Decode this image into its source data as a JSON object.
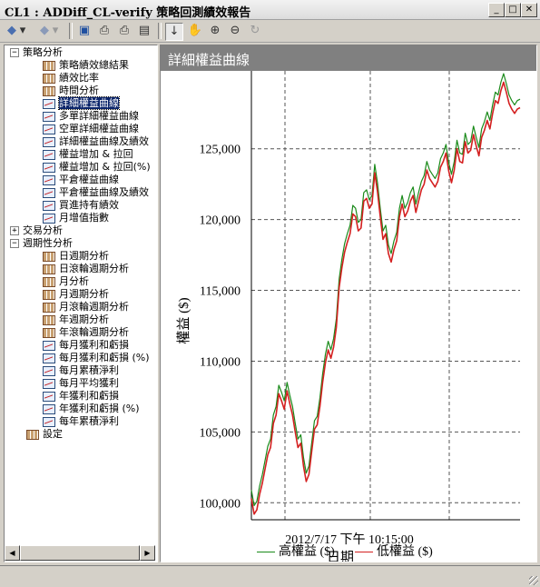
{
  "window": {
    "title": "CL1 : ADDiff_CL-verify 策略回測績效報告",
    "minimize": "_",
    "maximize": "□",
    "close": "✕"
  },
  "toolbar": {
    "back": "◆",
    "back_dd": "▾",
    "forward": "◆",
    "forward_dd": "▾",
    "save": "▣",
    "preview": "⎙",
    "print": "⎙",
    "grid": "▤",
    "pointer": "↓",
    "pan": "✋",
    "zoom_in": "⊕",
    "zoom_out": "⊖",
    "reset": "↻"
  },
  "tree": {
    "items": [
      {
        "label": "策略分析",
        "type": "group",
        "expander": "−"
      },
      {
        "label": "策略績效總結果",
        "type": "leaf"
      },
      {
        "label": "績效比率",
        "type": "leaf"
      },
      {
        "label": "時間分析",
        "type": "leaf"
      },
      {
        "label": "詳細權益曲線",
        "type": "chart",
        "selected": true
      },
      {
        "label": "多單詳細權益曲線",
        "type": "chart"
      },
      {
        "label": "空單詳細權益曲線",
        "type": "chart"
      },
      {
        "label": "詳細權益曲線及績效",
        "type": "chart"
      },
      {
        "label": "權益增加 & 拉回",
        "type": "chart"
      },
      {
        "label": "權益增加 & 拉回(%)",
        "type": "chart"
      },
      {
        "label": "平倉權益曲線",
        "type": "chart"
      },
      {
        "label": "平倉權益曲線及績效",
        "type": "chart"
      },
      {
        "label": "買進持有績效",
        "type": "chart"
      },
      {
        "label": "月增值指數",
        "type": "chart"
      },
      {
        "label": "交易分析",
        "type": "group",
        "expander": "+"
      },
      {
        "label": "週期性分析",
        "type": "group",
        "expander": "−"
      },
      {
        "label": "日週期分析",
        "type": "leaf"
      },
      {
        "label": "日滾輪週期分析",
        "type": "leaf"
      },
      {
        "label": "月分析",
        "type": "leaf"
      },
      {
        "label": "月週期分析",
        "type": "leaf"
      },
      {
        "label": "月滾輪週期分析",
        "type": "leaf"
      },
      {
        "label": "年週期分析",
        "type": "leaf"
      },
      {
        "label": "年滾輪週期分析",
        "type": "leaf"
      },
      {
        "label": "每月獲利和虧損",
        "type": "chart"
      },
      {
        "label": "每月獲利和虧損 (%)",
        "type": "chart"
      },
      {
        "label": "每月累積淨利",
        "type": "chart"
      },
      {
        "label": "每月平均獲利",
        "type": "chart"
      },
      {
        "label": "年獲利和虧損",
        "type": "chart"
      },
      {
        "label": "年獲利和虧損 (%)",
        "type": "chart"
      },
      {
        "label": "每年累積淨利",
        "type": "chart"
      },
      {
        "label": "設定",
        "type": "leaf"
      }
    ]
  },
  "scroll": {
    "left": "◀",
    "right": "▶"
  },
  "panel": {
    "title": "詳細權益曲線"
  },
  "chart_data": {
    "type": "line",
    "title": "",
    "xlabel": "日期",
    "ylabel": "權益 ($)",
    "xtick_label": "2012/7/17 下午 10:15:00",
    "yticks": [
      100000,
      105000,
      110000,
      115000,
      120000,
      125000
    ],
    "ytick_labels": [
      "100,000",
      "105,000",
      "110,000",
      "115,000",
      "120,000",
      "125,000"
    ],
    "ylim": [
      98800,
      130500
    ],
    "grid": true,
    "legend_position": "bottom",
    "x": [
      0,
      3,
      6,
      9,
      12,
      15,
      18,
      21,
      24,
      27,
      30,
      33,
      36,
      39,
      42,
      45,
      48,
      51,
      54,
      57,
      60,
      63,
      66,
      69,
      72,
      75,
      78,
      81,
      84,
      87,
      90,
      93,
      96,
      99,
      102,
      105,
      108,
      111,
      114,
      117,
      120,
      123,
      126,
      129,
      132,
      135,
      138,
      141,
      144,
      147,
      150,
      153,
      156,
      159,
      162,
      165,
      168,
      171,
      174,
      177,
      180,
      183,
      186,
      189,
      192,
      195,
      198,
      201,
      204,
      207,
      210,
      213,
      216,
      219,
      222,
      225,
      228,
      231,
      234,
      237,
      240,
      243,
      246,
      249,
      252,
      255,
      258,
      261,
      264,
      267,
      270,
      273,
      276,
      279,
      282,
      285,
      288,
      291,
      294
    ],
    "series": [
      {
        "name": "高權益 ($)",
        "color": "#1a8a1a",
        "values": [
          100900,
          99800,
          100100,
          101200,
          102000,
          103000,
          104000,
          104500,
          106200,
          106800,
          108300,
          107800,
          107200,
          108500,
          107600,
          106800,
          105600,
          104500,
          104800,
          103200,
          102100,
          102600,
          104200,
          105800,
          106100,
          107400,
          109100,
          110500,
          111400,
          110800,
          111600,
          113000,
          115800,
          117200,
          118300,
          119000,
          119600,
          121000,
          120800,
          119800,
          120000,
          121900,
          122100,
          121400,
          121700,
          123900,
          122600,
          120800,
          119200,
          119600,
          118200,
          117600,
          118500,
          119100,
          120800,
          121700,
          120800,
          121200,
          121900,
          122300,
          121100,
          121900,
          122700,
          123100,
          124100,
          123500,
          123200,
          122900,
          123300,
          124300,
          124700,
          125300,
          124000,
          123200,
          124100,
          125600,
          124700,
          124600,
          126100,
          125300,
          125500,
          126600,
          125800,
          125100,
          126400,
          126900,
          127600,
          127000,
          128100,
          129000,
          128800,
          129700,
          130300,
          129600,
          128800,
          128400,
          128100,
          128400,
          128500
        ]
      },
      {
        "name": "低權益 ($)",
        "color": "#d42020",
        "values": [
          100300,
          99200,
          99500,
          100600,
          101400,
          102400,
          103400,
          103900,
          105600,
          106200,
          107700,
          107200,
          106600,
          107900,
          107000,
          106200,
          105000,
          103900,
          104200,
          102600,
          101500,
          102000,
          103600,
          105200,
          105500,
          106800,
          108500,
          109900,
          110800,
          110200,
          111000,
          112400,
          115200,
          116600,
          117700,
          118400,
          119000,
          120400,
          120200,
          119200,
          119400,
          121300,
          121500,
          120800,
          121100,
          123300,
          122000,
          120200,
          118600,
          119000,
          117600,
          117000,
          117900,
          118500,
          120200,
          121100,
          120200,
          120600,
          121300,
          121700,
          120500,
          121300,
          122100,
          122500,
          123500,
          122900,
          122600,
          122300,
          122700,
          123700,
          124100,
          124700,
          123400,
          122600,
          123500,
          125000,
          124100,
          124000,
          125500,
          124700,
          124900,
          126000,
          125200,
          124500,
          125800,
          126300,
          127000,
          126400,
          127500,
          128400,
          128200,
          129100,
          129700,
          129000,
          128200,
          127800,
          127500,
          127800,
          127900
        ]
      }
    ]
  }
}
